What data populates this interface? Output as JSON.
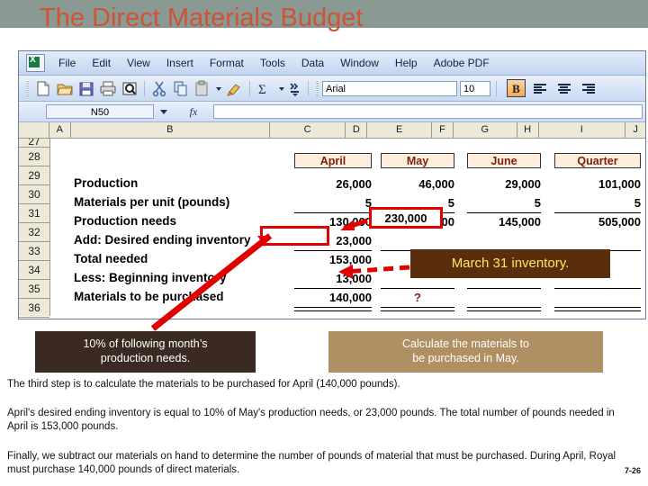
{
  "slide": {
    "title": "The Direct Materials Budget",
    "title_color": "#cd5434",
    "band_color": "#8a9a92",
    "page_number": "7-26"
  },
  "excel": {
    "menu": [
      {
        "label": "File",
        "mnemonic": "F"
      },
      {
        "label": "Edit",
        "mnemonic": "E"
      },
      {
        "label": "View",
        "mnemonic": "V"
      },
      {
        "label": "Insert",
        "mnemonic": "I"
      },
      {
        "label": "Format",
        "mnemonic": "o"
      },
      {
        "label": "Tools",
        "mnemonic": "T"
      },
      {
        "label": "Data",
        "mnemonic": "D"
      },
      {
        "label": "Window",
        "mnemonic": "W"
      },
      {
        "label": "Help",
        "mnemonic": "H"
      },
      {
        "label": "Adobe PDF",
        "mnemonic": "b"
      }
    ],
    "toolbar_icons": [
      "new-icon",
      "open-icon",
      "save-icon",
      "print-icon",
      "print-preview-icon",
      "cut-icon",
      "copy-icon",
      "paste-icon",
      "format-painter-icon",
      "autosum-icon"
    ],
    "font_name": "Arial",
    "font_size": "10",
    "bold_label": "B",
    "bold_active": true,
    "name_box": "N50",
    "formula_value": "",
    "fx_label": "fx",
    "columns": [
      "A",
      "B",
      "C",
      "D",
      "E",
      "F",
      "G",
      "H",
      "I",
      "J"
    ],
    "row_numbers": [
      "27",
      "28",
      "29",
      "30",
      "31",
      "32",
      "33",
      "34",
      "35",
      "36"
    ],
    "month_headers": [
      "April",
      "May",
      "June",
      "Quarter"
    ],
    "rows": [
      {
        "label": "Production",
        "values": [
          "26,000",
          "46,000",
          "29,000",
          "101,000"
        ]
      },
      {
        "label": "Materials per unit (pounds)",
        "values": [
          "5",
          "5",
          "5",
          "5"
        ]
      },
      {
        "label": "Production needs",
        "values": [
          "130,000",
          "230,000",
          "145,000",
          "505,000"
        ]
      },
      {
        "label": "Add: Desired ending inventory",
        "values": [
          "23,000",
          "",
          "",
          ""
        ]
      },
      {
        "label": "Total needed",
        "values": [
          "153,000",
          "",
          "",
          ""
        ]
      },
      {
        "label": "Less: Beginning inventory",
        "values": [
          "13,000",
          "",
          "",
          ""
        ]
      },
      {
        "label": "Materials to be purchased",
        "values": [
          "140,000",
          "?",
          "",
          ""
        ]
      }
    ]
  },
  "callouts": {
    "ending_inventory_rule": "10% of following month’s\nproduction needs.",
    "ending_inventory_rule_line1": "10% of following month’s",
    "ending_inventory_rule_line2": "production needs.",
    "task_line1": "Calculate the materials to",
    "task_line2": "be purchased in May.",
    "march_inventory": "March 31 inventory.",
    "may_production_needs": "230,000"
  },
  "body_text": {
    "p1": "The third step is to calculate the materials to be purchased for April (140,000 pounds).",
    "p2": "April's desired ending inventory is equal to 10% of May's production needs, or 23,000 pounds. The total number of pounds needed in April is 153,000 pounds.",
    "p3": "Finally, we subtract our materials on hand to determine the number of pounds of material that must be purchased. During April, Royal must purchase 140,000 pounds of direct materials."
  }
}
